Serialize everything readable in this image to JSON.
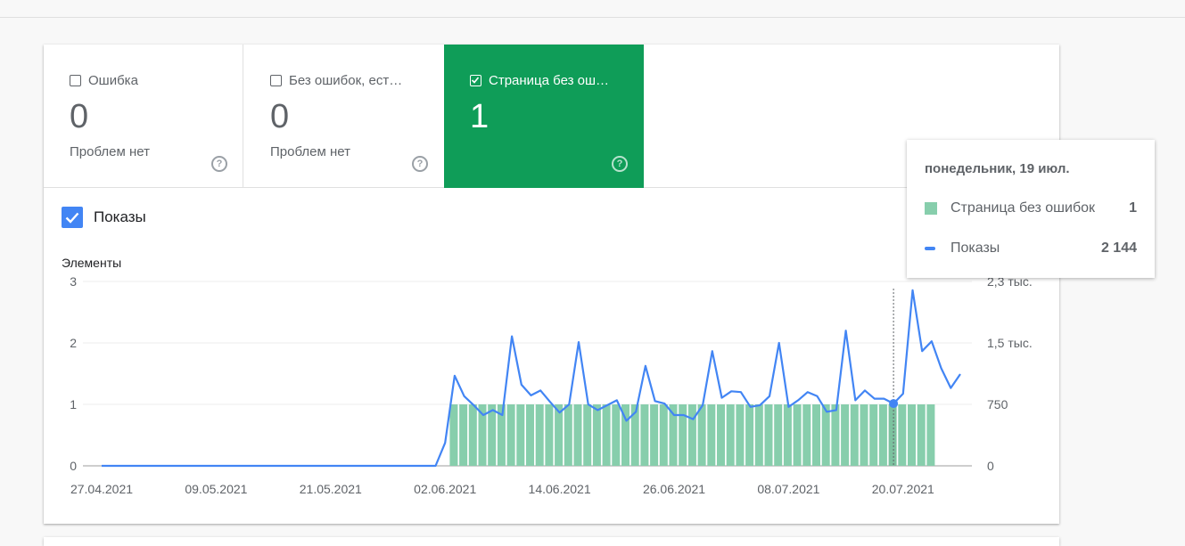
{
  "tiles": [
    {
      "label": "Ошибка",
      "value": "0",
      "sub": "Проблем нет",
      "checked": false
    },
    {
      "label": "Без ошибок, ест…",
      "value": "0",
      "sub": "Проблем нет",
      "checked": false
    },
    {
      "label": "Страница без ош…",
      "value": "1",
      "sub": "",
      "checked": true
    }
  ],
  "metric": {
    "label": "Показы",
    "checked": true
  },
  "colors": {
    "bar": "#87ceac",
    "line": "#4285f4",
    "selected_tile": "#0f9d58"
  },
  "tooltip": {
    "date": "понедельник, 19 июл.",
    "rows": [
      {
        "name": "Страница без ошибок",
        "value": "1"
      },
      {
        "name": "Показы",
        "value": "2 144"
      }
    ]
  },
  "chart_data": {
    "type": "bar+line",
    "left_axis_title": "Элементы",
    "right_axis_title": "Показы",
    "left_ticks": [
      "0",
      "1",
      "2",
      "3"
    ],
    "right_ticks": [
      "0",
      "750",
      "1,5 тыс.",
      "2,3 тыс."
    ],
    "ylim_left": [
      0,
      3
    ],
    "ylim_right": [
      0,
      2250
    ],
    "x_tick_labels": [
      "27.04.2021",
      "09.05.2021",
      "21.05.2021",
      "02.06.2021",
      "14.06.2021",
      "26.06.2021",
      "08.07.2021",
      "20.07.2021"
    ],
    "start_date": "2021-04-27",
    "bar_series": {
      "name": "Страница без ошибок",
      "first_bar_date": "2021-06-03",
      "last_bar_date": "2021-07-23",
      "value": 1
    },
    "line_series": {
      "name": "Показы",
      "first_date": "2021-04-27",
      "values": [
        0,
        0,
        0,
        0,
        0,
        0,
        0,
        0,
        0,
        0,
        0,
        0,
        0,
        0,
        0,
        0,
        0,
        0,
        0,
        0,
        0,
        0,
        0,
        0,
        0,
        0,
        0,
        0,
        0,
        0,
        0,
        0,
        0,
        0,
        0,
        0,
        280,
        1100,
        850,
        740,
        620,
        680,
        620,
        1580,
        990,
        860,
        920,
        780,
        650,
        750,
        1510,
        750,
        680,
        740,
        800,
        550,
        660,
        1220,
        790,
        760,
        620,
        620,
        570,
        740,
        1400,
        830,
        910,
        900,
        720,
        740,
        850,
        1500,
        720,
        800,
        900,
        850,
        660,
        680,
        1650,
        800,
        920,
        820,
        820,
        760,
        880,
        2144,
        1400,
        1520,
        1190,
        950,
        1120
      ]
    },
    "highlight_date": "2021-07-19"
  }
}
